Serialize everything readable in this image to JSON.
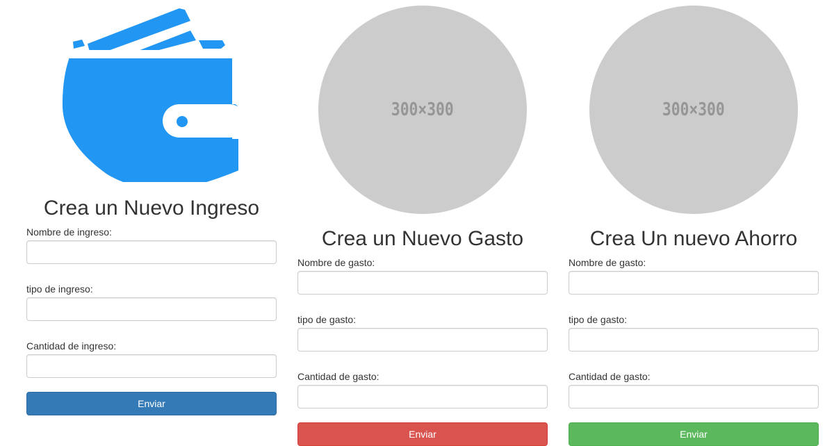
{
  "colors": {
    "wallet_blue": "#2196F3",
    "placeholder_gray": "#CCCCCC",
    "primary": "#337AB7",
    "danger": "#D9534F",
    "success": "#5CB85C"
  },
  "ingreso": {
    "image_icon": "wallet-icon",
    "title": "Crea un Nuevo Ingreso",
    "fields": [
      {
        "label": "Nombre de ingreso:",
        "value": "",
        "placeholder": ""
      },
      {
        "label": "tipo de ingreso:",
        "value": "",
        "placeholder": ""
      },
      {
        "label": "Cantidad de ingreso:",
        "value": "",
        "placeholder": ""
      }
    ],
    "submit_label": "Enviar"
  },
  "gasto": {
    "image_text": "300×300",
    "title": "Crea un Nuevo Gasto",
    "fields": [
      {
        "label": "Nombre de gasto:",
        "value": "",
        "placeholder": ""
      },
      {
        "label": "tipo de gasto:",
        "value": "",
        "placeholder": ""
      },
      {
        "label": "Cantidad de gasto:",
        "value": "",
        "placeholder": ""
      }
    ],
    "submit_label": "Enviar"
  },
  "ahorro": {
    "image_text": "300×300",
    "title": "Crea Un nuevo Ahorro",
    "fields": [
      {
        "label": "Nombre de gasto:",
        "value": "",
        "placeholder": ""
      },
      {
        "label": "tipo de gasto:",
        "value": "",
        "placeholder": ""
      },
      {
        "label": "Cantidad de gasto:",
        "value": "",
        "placeholder": ""
      }
    ],
    "submit_label": "Enviar"
  }
}
